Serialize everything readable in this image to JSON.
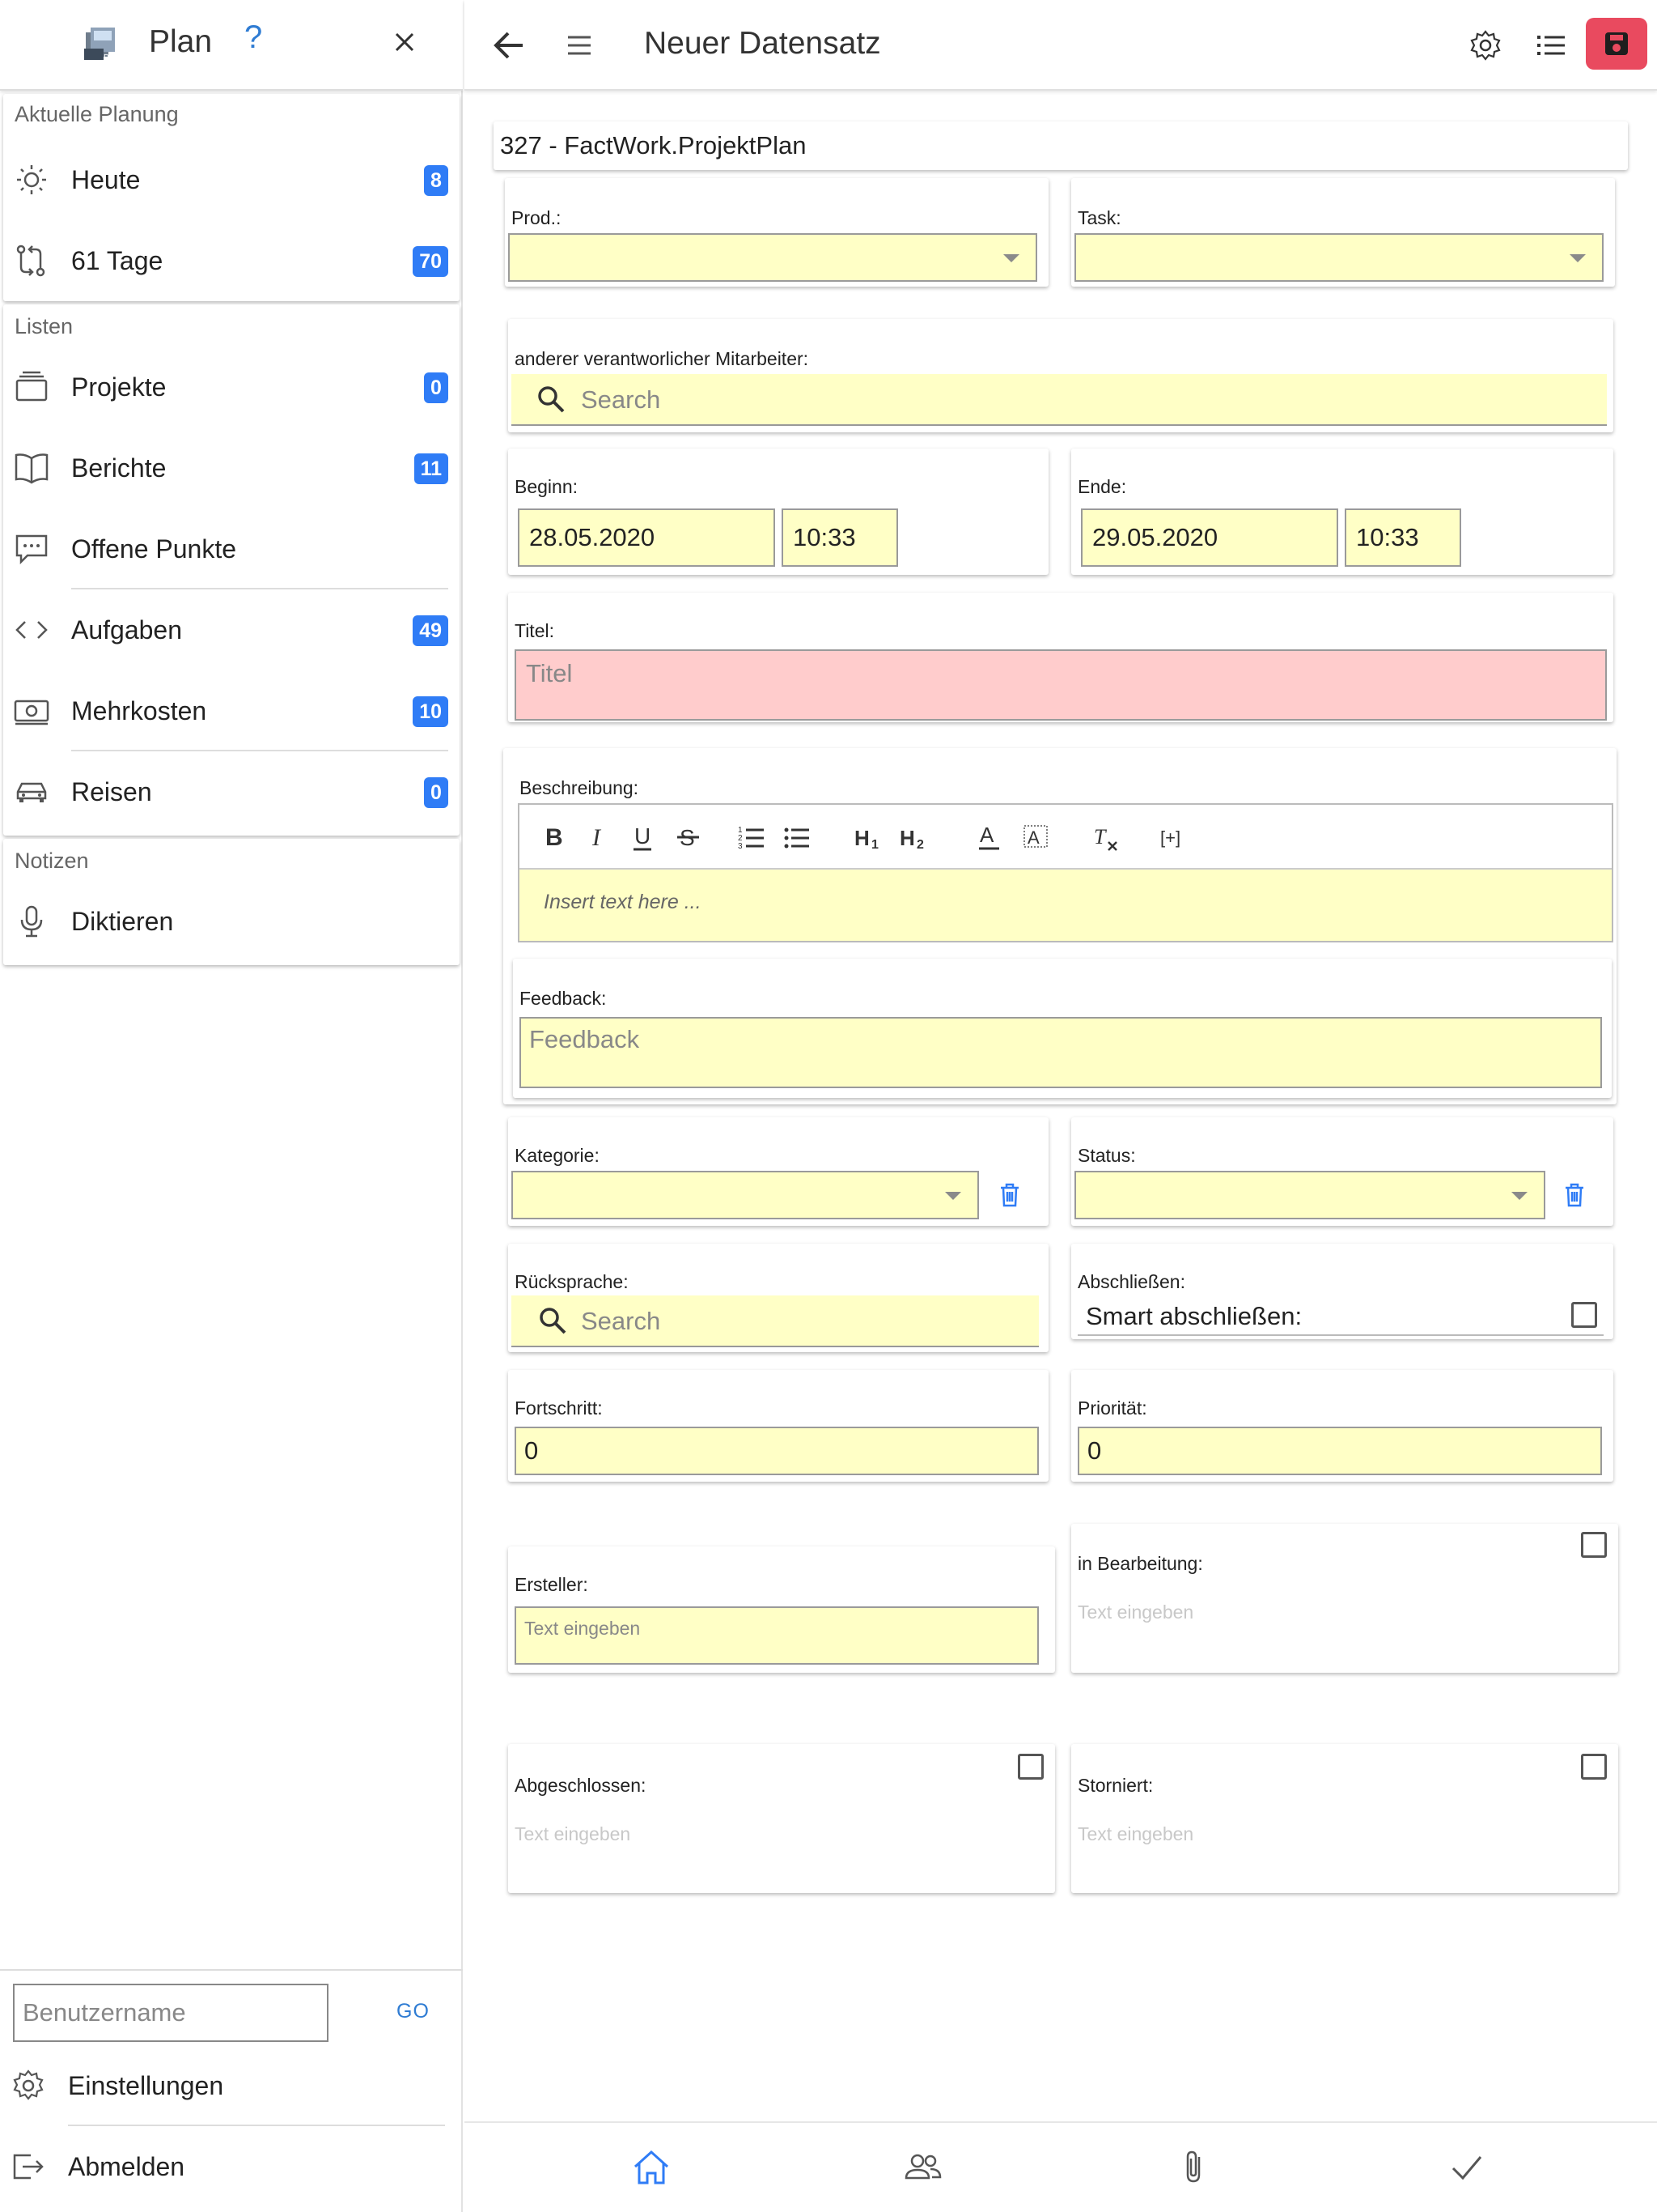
{
  "sidebar": {
    "header": {
      "title": "Plan",
      "help": "?"
    },
    "sections": {
      "current": {
        "title": "Aktuelle Planung",
        "items": [
          {
            "label": "Heute",
            "badge": "8",
            "icon": "sun-icon"
          },
          {
            "label": "61 Tage",
            "badge": "70",
            "icon": "git-compare-icon"
          }
        ]
      },
      "lists": {
        "title": "Listen",
        "items": [
          {
            "label": "Projekte",
            "badge": "0",
            "icon": "folder-stack-icon"
          },
          {
            "label": "Berichte",
            "badge": "11",
            "icon": "book-icon"
          },
          {
            "label": "Offene Punkte",
            "badge": "",
            "icon": "chat-bubble-icon"
          },
          {
            "label": "Aufgaben",
            "badge": "49",
            "icon": "code-icon"
          },
          {
            "label": "Mehrkosten",
            "badge": "10",
            "icon": "money-icon"
          },
          {
            "label": "Reisen",
            "badge": "0",
            "icon": "car-icon"
          }
        ]
      },
      "notes": {
        "title": "Notizen",
        "items": [
          {
            "label": "Diktieren",
            "icon": "microphone-icon"
          }
        ]
      }
    },
    "footer": {
      "username_placeholder": "Benutzername",
      "go_label": "GO",
      "settings_label": "Einstellungen",
      "logout_label": "Abmelden"
    }
  },
  "topbar": {
    "title": "Neuer Datensatz"
  },
  "form": {
    "record_label": "327 - FactWork.ProjektPlan",
    "prod": {
      "label": "Prod.:",
      "value": ""
    },
    "task": {
      "label": "Task:",
      "value": ""
    },
    "mitarbeiter": {
      "label": "anderer verantworlicher Mitarbeiter:",
      "placeholder": "Search"
    },
    "beginn": {
      "label": "Beginn:",
      "date": "28.05.2020",
      "time": "10:33"
    },
    "ende": {
      "label": "Ende:",
      "date": "29.05.2020",
      "time": "10:33"
    },
    "titel": {
      "label": "Titel:",
      "placeholder": "Titel"
    },
    "beschreibung": {
      "label": "Beschreibung:",
      "placeholder": "Insert text here ...",
      "toolbar": [
        "B",
        "I",
        "U",
        "S",
        "ol",
        "ul",
        "H1",
        "H2",
        "A",
        "A-bg",
        "Tx",
        "[+]"
      ]
    },
    "feedback": {
      "label": "Feedback:",
      "placeholder": "Feedback"
    },
    "kategorie": {
      "label": "Kategorie:",
      "value": ""
    },
    "status": {
      "label": "Status:",
      "value": ""
    },
    "ruecksprache": {
      "label": "Rücksprache:",
      "placeholder": "Search"
    },
    "abschliessen": {
      "label": "Abschließen:",
      "text": "Smart abschließen:",
      "checked": false
    },
    "fortschritt": {
      "label": "Fortschritt:",
      "value": "0"
    },
    "prioritaet": {
      "label": "Priorität:",
      "value": "0"
    },
    "ersteller": {
      "label": "Ersteller:",
      "placeholder": "Text eingeben"
    },
    "in_bearbeitung": {
      "label": "in Bearbeitung:",
      "placeholder": "Text eingeben",
      "checked": false
    },
    "abgeschlossen": {
      "label": "Abgeschlossen:",
      "placeholder": "Text eingeben",
      "checked": false
    },
    "storniert": {
      "label": "Storniert:",
      "placeholder": "Text eingeben",
      "checked": false
    }
  },
  "bottom_bar": {
    "items": [
      "home-icon",
      "people-icon",
      "paperclip-icon",
      "checkmark-icon"
    ],
    "active": "home-icon"
  },
  "colors": {
    "accent": "#2f7cf6",
    "save": "#e94a5f",
    "field_yellow": "#ffffc6",
    "field_error": "#ffcccc"
  }
}
